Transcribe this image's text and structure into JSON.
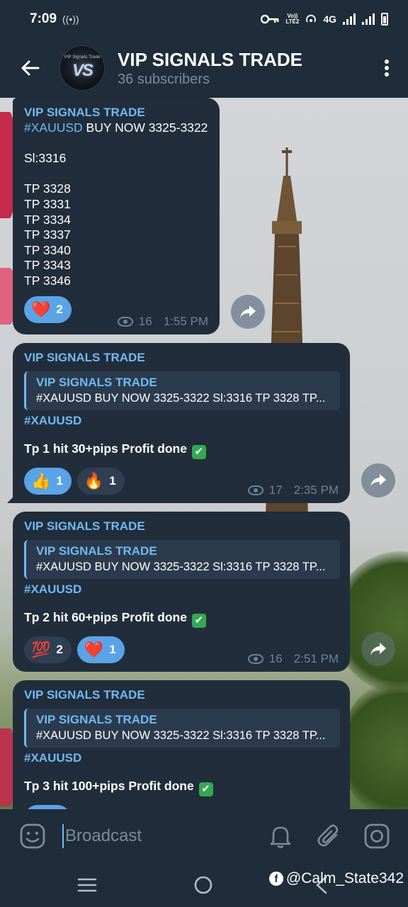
{
  "status_bar": {
    "time": "7:09",
    "left_icon": "hotspot-icon",
    "vol_label": "Vo))\nLTE2",
    "network": "4G"
  },
  "header": {
    "title": "VIP SIGNALS TRADE",
    "subtitle": "36 subscribers",
    "avatar_top": "VIP Signals Trade",
    "avatar_logo": "VS"
  },
  "messages": [
    {
      "author": "VIP SIGNALS TRADE",
      "hashtag": "#XAUUSD",
      "text_after_hashtag": " BUY NOW 3325-3322",
      "body": "\nSl:3316\n\nTP 3328\nTP 3331\nTP 3334\nTP 3337\nTP 3340\nTP 3343\nTP 3346",
      "reactions": [
        {
          "emoji": "❤️",
          "count": "2"
        }
      ],
      "views": "16",
      "time": "1:55 PM"
    },
    {
      "author": "VIP SIGNALS TRADE",
      "reply_author": "VIP SIGNALS TRADE",
      "reply_text": "#XAUUSD BUY NOW 3325-3322  Sl:3316  TP 3328 TP...",
      "hashtag": "#XAUUSD",
      "hit": "Tp 1 hit 30+pips Profit done",
      "reactions": [
        {
          "emoji": "👍",
          "count": "1"
        },
        {
          "emoji": "🔥",
          "count": "1"
        }
      ],
      "views": "17",
      "time": "2:35 PM"
    },
    {
      "author": "VIP SIGNALS TRADE",
      "reply_author": "VIP SIGNALS TRADE",
      "reply_text": "#XAUUSD BUY NOW 3325-3322  Sl:3316  TP 3328 TP...",
      "hashtag": "#XAUUSD",
      "hit": "Tp 2 hit 60+pips Profit done",
      "reactions": [
        {
          "emoji": "💯",
          "count": "2"
        },
        {
          "emoji": "❤️",
          "count": "1"
        }
      ],
      "views": "16",
      "time": "2:51 PM"
    },
    {
      "author": "VIP SIGNALS TRADE",
      "reply_author": "VIP SIGNALS TRADE",
      "reply_text": "#XAUUSD BUY NOW 3325-3322  Sl:3316  TP 3328 TP...",
      "hashtag": "#XAUUSD",
      "hit": "Tp 3 hit 100+pips Profit done"
    }
  ],
  "input": {
    "placeholder": "Broadcast"
  },
  "watermark": "@Calm_State342",
  "colors": {
    "accent": "#71b9f0",
    "bubble": "#212d3b",
    "header": "#1f2c39",
    "reaction_mine": "#5aa3e6"
  }
}
